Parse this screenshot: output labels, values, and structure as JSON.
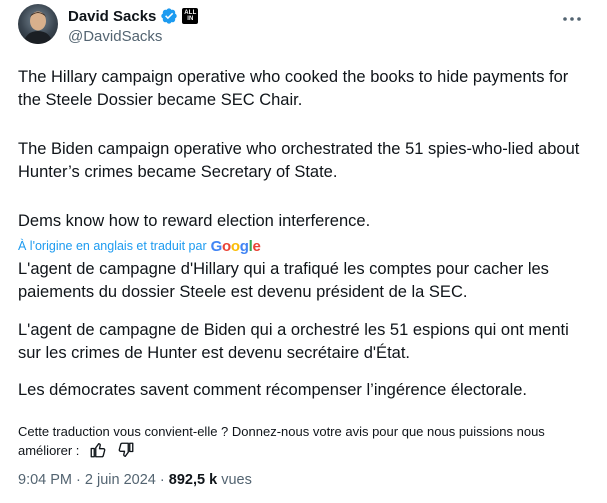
{
  "author": {
    "display_name": "David Sacks",
    "handle": "@DavidSacks",
    "affiliation_badge": "ALL IN",
    "verified_color": "#1d9bf0"
  },
  "tweet": {
    "paragraphs": [
      "The Hillary campaign operative who cooked the books to hide payments for the Steele Dossier became SEC Chair.",
      "The Biden campaign operative who orchestrated the 51 spies-who-lied about Hunter’s crimes became Secretary of State.",
      "Dems know how to reward election interference."
    ]
  },
  "translation": {
    "notice": "À l'origine en anglais et traduit par",
    "provider": "Google",
    "paragraphs": [
      "L'agent de campagne d'Hillary qui a trafiqué les comptes pour cacher les paiements du dossier Steele est devenu président de la SEC.",
      "L'agent de campagne de Biden qui a orchestré les 51 espions qui ont menti sur les crimes de Hunter est devenu secrétaire d'État.",
      "Les démocrates savent comment récompenser l’ingérence électorale."
    ],
    "feedback_prompt": "Cette traduction vous convient-elle ? Donnez-nous votre avis pour que nous puissions nous améliorer :"
  },
  "meta": {
    "time": "9:04 PM",
    "separator": "·",
    "date": "2 juin 2024",
    "views_count": "892,5 k",
    "views_label": "vues"
  },
  "colors": {
    "text": "#0f1419",
    "secondary": "#536471",
    "link": "#1d9bf0"
  }
}
